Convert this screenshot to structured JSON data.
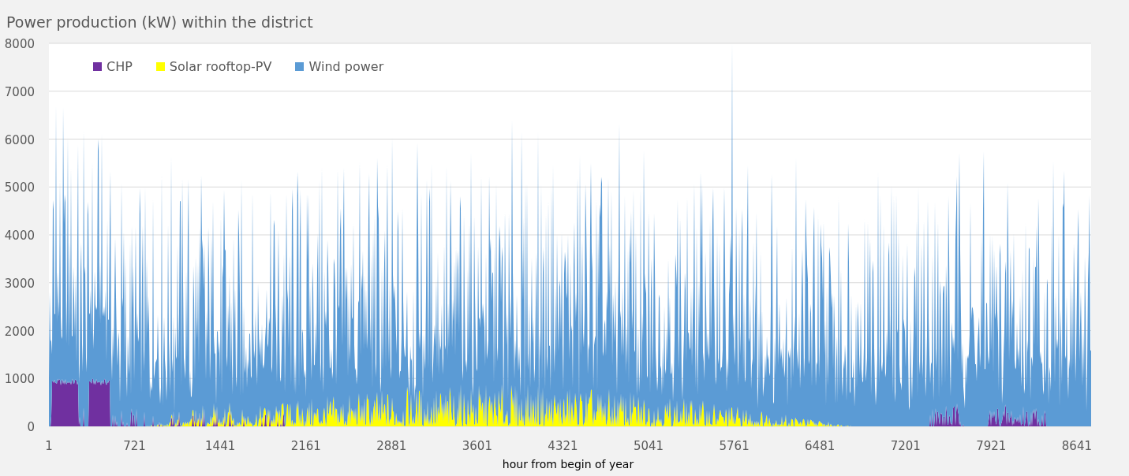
{
  "title": "Power production (kW) within the district",
  "legend": [
    {
      "label": "CHP",
      "color": "#7030a0"
    },
    {
      "label": "Solar rooftop-PV",
      "color": "#ffff00"
    },
    {
      "label": "Wind power",
      "color": "#5b9bd5"
    }
  ],
  "y_axis": {
    "ticks": [
      "8000",
      "7000",
      "6000",
      "5000",
      "4000",
      "3000",
      "2000",
      "1000",
      "0"
    ]
  },
  "x_axis": {
    "ticks": [
      "1",
      "721",
      "1441",
      "2161",
      "2881",
      "3601",
      "4321",
      "5041",
      "5761",
      "6481",
      "7201",
      "7921",
      "8641"
    ],
    "title": "hour from begin of year"
  }
}
